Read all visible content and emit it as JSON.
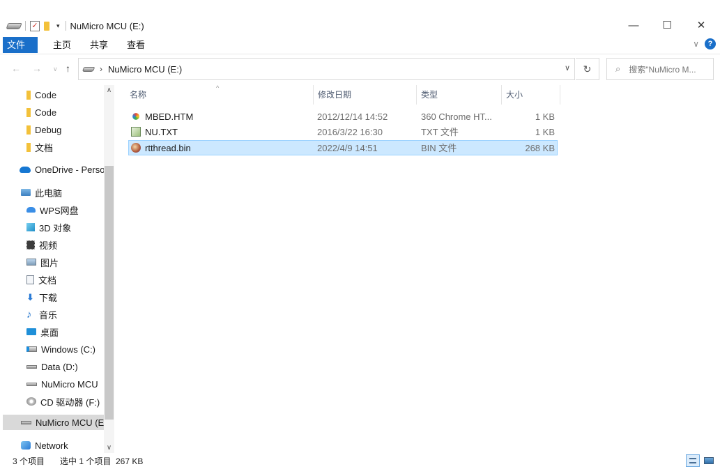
{
  "window": {
    "title": "NuMicro MCU (E:)",
    "minimize_glyph": "—",
    "maximize_glyph": "☐",
    "close_glyph": "✕"
  },
  "ribbon": {
    "tabs": [
      "文件",
      "主页",
      "共享",
      "查看"
    ]
  },
  "address": {
    "path": "NuMicro MCU (E:)",
    "search_placeholder": "搜索\"NuMicro M..."
  },
  "nav": {
    "items": [
      {
        "label": "Code",
        "icon": "folder-icon"
      },
      {
        "label": "Code",
        "icon": "folder-icon"
      },
      {
        "label": "Debug",
        "icon": "folder-icon"
      },
      {
        "label": "文档",
        "icon": "folder-icon"
      },
      {
        "label": "OneDrive - Perso",
        "icon": "cloud-icon"
      },
      {
        "label": "此电脑",
        "icon": "computer-icon"
      },
      {
        "label": "WPS网盘",
        "icon": "wps-cloud-icon"
      },
      {
        "label": "3D 对象",
        "icon": "cube-icon"
      },
      {
        "label": "视频",
        "icon": "video-icon"
      },
      {
        "label": "图片",
        "icon": "picture-icon"
      },
      {
        "label": "文档",
        "icon": "document-icon"
      },
      {
        "label": "下载",
        "icon": "download-icon"
      },
      {
        "label": "音乐",
        "icon": "music-icon"
      },
      {
        "label": "桌面",
        "icon": "desktop-icon"
      },
      {
        "label": "Windows (C:)",
        "icon": "windows-drive-icon"
      },
      {
        "label": "Data (D:)",
        "icon": "drive-icon"
      },
      {
        "label": "NuMicro MCU",
        "icon": "drive-icon"
      },
      {
        "label": "CD 驱动器 (F:)",
        "icon": "cd-drive-icon"
      },
      {
        "label": "NuMicro MCU (E",
        "icon": "drive-icon"
      },
      {
        "label": "Network",
        "icon": "network-icon"
      }
    ]
  },
  "columns": {
    "name": "名称",
    "date": "修改日期",
    "type": "类型",
    "size": "大小"
  },
  "files": [
    {
      "name": "MBED.HTM",
      "date": "2012/12/14 14:52",
      "type": "360 Chrome HT...",
      "size": "1 KB",
      "icon": "html-file-icon"
    },
    {
      "name": "NU.TXT",
      "date": "2016/3/22 16:30",
      "type": "TXT 文件",
      "size": "1 KB",
      "icon": "text-file-icon"
    },
    {
      "name": "rtthread.bin",
      "date": "2022/4/9 14:51",
      "type": "BIN 文件",
      "size": "268 KB",
      "icon": "bin-file-icon"
    }
  ],
  "status": {
    "item_count": "3 个项目",
    "selection": "选中 1 个项目  267 KB"
  },
  "colors": {
    "accent": "#1a6fc9",
    "selection_bg": "#cce8ff",
    "selection_border": "#99d1ff"
  }
}
